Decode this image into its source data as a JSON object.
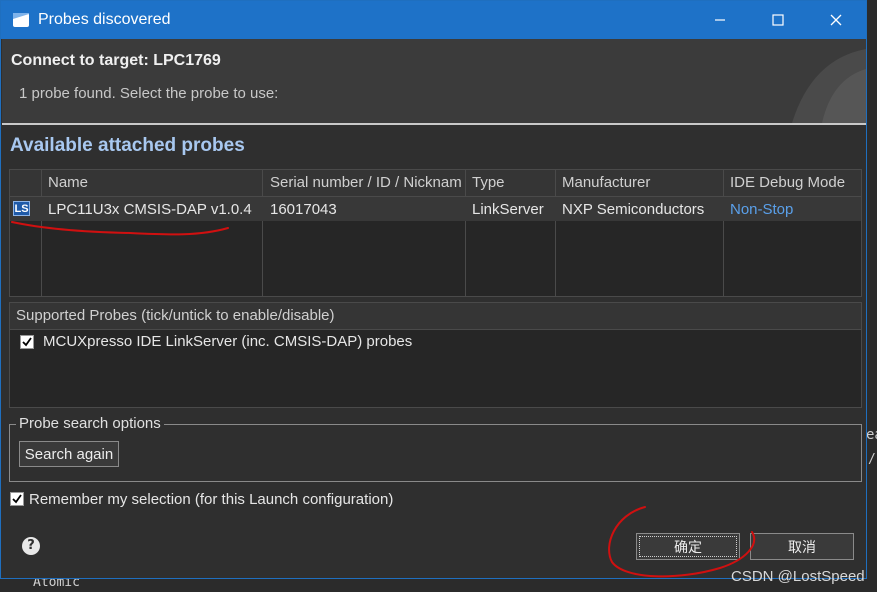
{
  "window": {
    "title": "Probes discovered"
  },
  "header": {
    "title": "Connect to target: LPC1769",
    "subtitle": "1 probe found. Select the probe to use:"
  },
  "attached": {
    "section_title": "Available attached probes",
    "columns": [
      "Name",
      "Serial number / ID / Nickname",
      "Type",
      "Manufacturer",
      "IDE Debug Mode"
    ],
    "rows": [
      {
        "icon": "LS",
        "name": "LPC11U3x CMSIS-DAP v1.0.4",
        "serial": "16017043",
        "type": "LinkServer",
        "manufacturer": "NXP Semiconductors",
        "debug_mode": "Non-Stop"
      }
    ]
  },
  "supported": {
    "header": "Supported Probes (tick/untick to enable/disable)",
    "items": [
      {
        "label": "MCUXpresso IDE LinkServer (inc. CMSIS-DAP) probes",
        "checked": true
      }
    ]
  },
  "search": {
    "group_label": "Probe search options",
    "button_label": "Search again"
  },
  "remember": {
    "label": "Remember my selection (for this Launch configuration)",
    "checked": true
  },
  "buttons": {
    "ok": "确定",
    "cancel": "取消"
  },
  "background": {
    "code_fragment": "Atomic",
    "side_fragment": "ea",
    "side_fragment2": "/"
  },
  "watermark": "CSDN @LostSpeed",
  "colors": {
    "titlebar": "#1e72c8",
    "section_title": "#a8c8f0",
    "link": "#5aa0ea",
    "annotation": "#d01010"
  },
  "icons": {
    "app": "app-window-icon",
    "minimize": "minimize-icon",
    "maximize": "maximize-icon",
    "close": "close-icon",
    "probe_type": "linkserver-icon",
    "help": "help-icon",
    "check": "checkmark-icon"
  }
}
